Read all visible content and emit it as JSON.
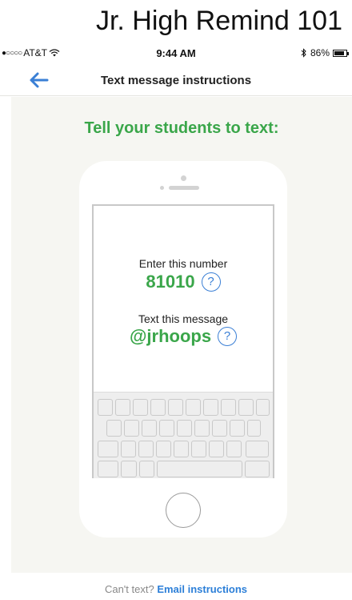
{
  "caption": "Jr. High Remind 101",
  "status_bar": {
    "signal_dots": "●○○○○",
    "carrier": "AT&T",
    "time": "9:44 AM",
    "battery_percent": "86%",
    "battery_level": 0.86
  },
  "nav": {
    "title": "Text message instructions",
    "back_icon": "arrow-left-icon"
  },
  "headline": "Tell your students to text:",
  "instructions": {
    "number_label": "Enter this number",
    "number_value": "81010",
    "message_label": "Text this message",
    "message_value": "@jrhoops",
    "help_glyph": "?"
  },
  "footer": {
    "prompt": "Can't text?",
    "link": "Email instructions"
  },
  "colors": {
    "accent_green": "#3aa64a",
    "link_blue": "#2c7fd8",
    "background": "#f6f6f2"
  }
}
